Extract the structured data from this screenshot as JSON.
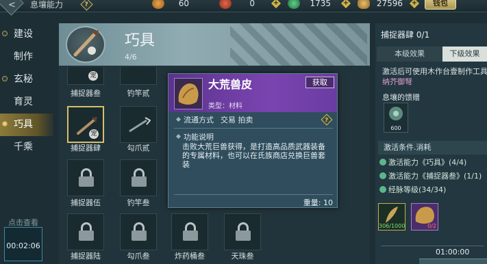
{
  "topbar": {
    "title": "息壤能力",
    "help_glyph": "?",
    "resources": [
      {
        "icon": "gold-coin-icon",
        "value": "60"
      },
      {
        "icon": "red-coin-icon",
        "value": "0"
      },
      {
        "icon": "jade-icon",
        "value": "1735"
      },
      {
        "icon": "feather-currency-icon",
        "value": "27596"
      }
    ],
    "plus_glyph": "+",
    "shop_button": "钱包"
  },
  "categories": [
    {
      "label": "建设",
      "active": false
    },
    {
      "label": "制作",
      "active": false
    },
    {
      "label": "玄秘",
      "active": false
    },
    {
      "label": "育灵",
      "active": false
    },
    {
      "label": "巧具",
      "active": true
    },
    {
      "label": "千乘",
      "active": false
    }
  ],
  "watch": {
    "label": "点击查看",
    "time": "00:02:06"
  },
  "header": {
    "title": "巧具",
    "count": "4/6",
    "badge": "宠"
  },
  "slots": [
    {
      "label": "捕捉器叁",
      "locked": false,
      "badge": "宠"
    },
    {
      "label": "钓竿贰",
      "locked": false,
      "badge": ""
    },
    {
      "label": "捕捉器肆",
      "locked": false,
      "badge": "宠",
      "selected": true
    },
    {
      "label": "勾爪贰",
      "locked": false,
      "badge": ""
    },
    {
      "label": "捕捉器伍",
      "locked": true
    },
    {
      "label": "钓竿叁",
      "locked": true
    },
    {
      "label": "捕捉器陆",
      "locked": true
    },
    {
      "label": "勾爪叁",
      "locked": true
    },
    {
      "label": "炸药桶叁",
      "locked": true
    },
    {
      "label": "天珠叁",
      "locked": true
    }
  ],
  "tooltip": {
    "name": "大荒兽皮",
    "get_button": "获取",
    "type": "类型：材料",
    "circulation": "流通方式",
    "circulation_value": "交易 拍卖",
    "desc_title": "功能说明",
    "desc": "击败大荒巨兽获得，是打造高品质武器装备的专属材料，也可以在氏族商店兑换巨兽套装",
    "weight": "重量: 10"
  },
  "right_panel": {
    "title": "捕捉器肆 0/1",
    "tabs": [
      "本级效果",
      "下级效果"
    ],
    "effect_line1": "激活后可使用木作台壹制作工具",
    "effect_line2": "纳芥御弩",
    "gift_title": "息壤的馈赠",
    "gift_count": "600",
    "section_title": "激活条件.消耗",
    "conditions": [
      "激活能力《巧具》(4/4)",
      "激活能力《捕捉器叁》(1/1)",
      "经脉等级(34/34)"
    ],
    "cost1": "306/1000",
    "cost2": "0/2",
    "timer": "01:00:00"
  },
  "colors": {
    "accent_gold": "#d7c06a",
    "rarity_purple": "#7a44b0",
    "highlight_pink": "#e1a0d4",
    "check_green": "#5db68b"
  }
}
